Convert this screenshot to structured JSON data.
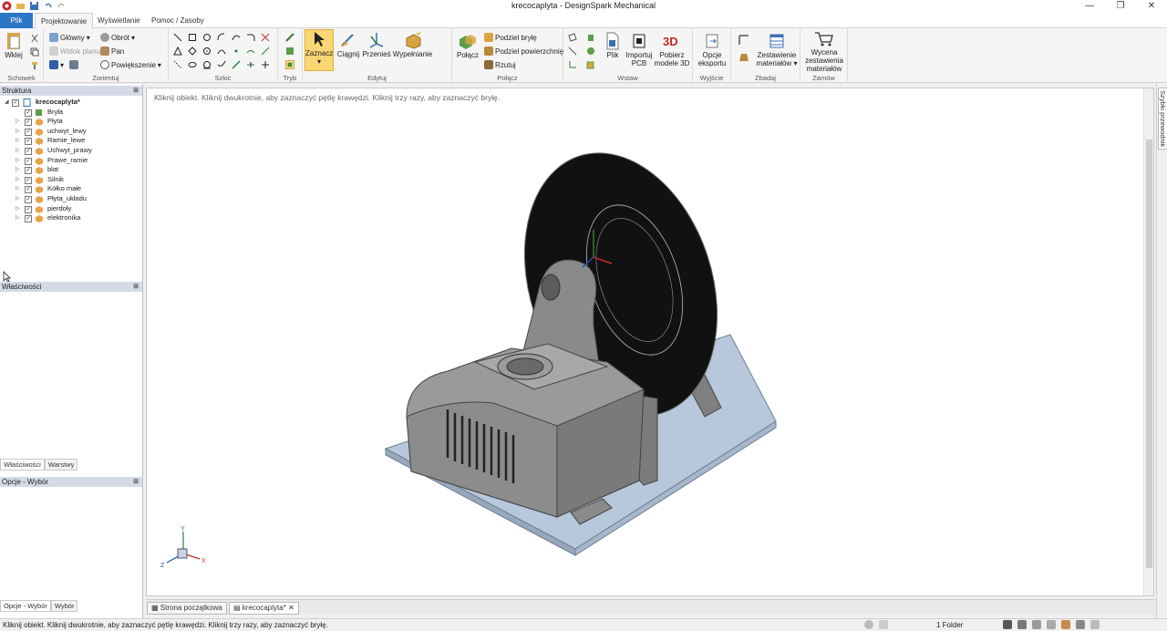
{
  "window": {
    "title": "krecocaplyta - DesignSpark Mechanical",
    "controls": [
      "—",
      "❐",
      "✕"
    ]
  },
  "tabs": [
    {
      "label": "Plik"
    },
    {
      "label": "Projektowanie"
    },
    {
      "label": "Wyświetlanie"
    },
    {
      "label": "Pomoc / Zasoby"
    }
  ],
  "ribbon": {
    "schowek": {
      "label": "Schowek",
      "paste": "Wklej"
    },
    "zorientuj": {
      "label": "Zorientuj",
      "home": "Główny",
      "rotate": "Obrót",
      "plan": "Widok planu",
      "pan": "Pan",
      "zoom": "Powiększenie"
    },
    "szkic": {
      "label": "Szkic"
    },
    "tryb": {
      "label": "Tryb"
    },
    "edytuj": {
      "label": "Edytuj",
      "select": "Zaznacz",
      "pull": "Ciągnij",
      "move": "Przenieś",
      "fill": "Wypełnianie"
    },
    "polacz": {
      "label": "Połącz",
      "combine": "Połącz",
      "split_body": "Podziel bryłę",
      "split_face": "Podziel powierzchnię",
      "project": "Rzutuj"
    },
    "wstaw": {
      "label": "Wstaw",
      "file": "Plik",
      "import_pcb": "Importuj PCB",
      "get3d": "Pobierz modele 3D"
    },
    "wyjscie": {
      "label": "Wyjście",
      "export": "Opcje eksportu"
    },
    "zbadaj": {
      "label": "Zbadaj",
      "bom": "Zestawienie materiałów"
    },
    "zamow": {
      "label": "Zamów",
      "quote": "Wycena zestawienia materiałów"
    }
  },
  "structure": {
    "title": "Struktura",
    "root": "krecocaplyta*",
    "items": [
      "Bryła",
      "Płyta",
      "uchwyt_lewy",
      "Ramie_lewe",
      "Uchwyt_prawy",
      "Prawe_ramie",
      "blat",
      "Silnik",
      "Kółko małe",
      "Płyta_układu",
      "pierdoły",
      "elektronika"
    ]
  },
  "properties": {
    "title": "Właściwości",
    "tabs": [
      "Właściwości",
      "Warstwy"
    ]
  },
  "options": {
    "title": "Opcje - Wybór",
    "tabs": [
      "Opcje - Wybór",
      "Wybór"
    ]
  },
  "viewport": {
    "hint": "Kliknij obiekt. Kliknij dwukrotnie, aby zaznaczyć pętlę krawędzi. Kliknij trzy razy, aby zaznaczyć bryłę."
  },
  "doc_tabs": [
    {
      "label": "Strona początkowa"
    },
    {
      "label": "krecocaplyta*"
    }
  ],
  "status": {
    "message": "Kliknij obiekt. Kliknij dwukrotnie, aby zaznaczyć pętlę krawędzi. Kliknij trzy razy, aby zaznaczyć bryłę.",
    "folder": "1 Folder"
  },
  "right_strip": {
    "label": "Szybki przewodnik"
  },
  "colors": {
    "file_tab": "#2b77c5",
    "panel_header": "#d4dbe6",
    "model": "#8f8f8f",
    "plate": "#b7c8dc"
  }
}
